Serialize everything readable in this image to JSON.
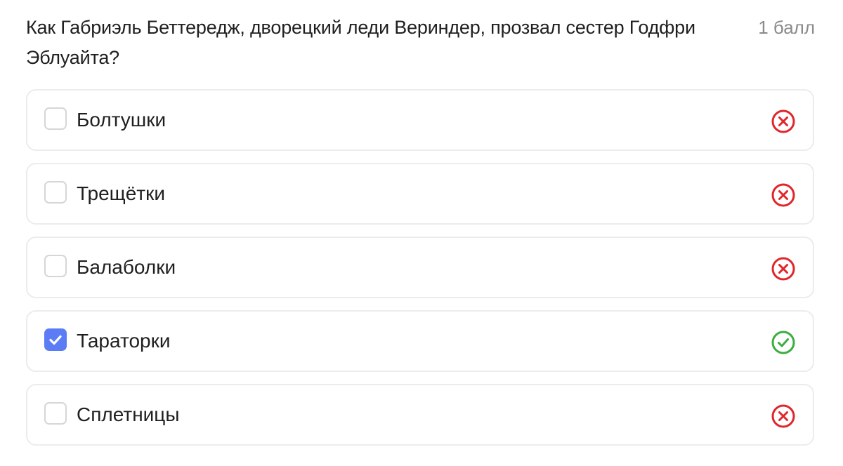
{
  "question": {
    "text": "Как Габриэль Беттередж, дворецкий леди Вериндер, прозвал сестер Годфри Эблуайта?",
    "score": "1 балл"
  },
  "options": [
    {
      "label": "Болтушки",
      "checked": false,
      "status": "incorrect",
      "icon": "x-circle-icon"
    },
    {
      "label": "Трещётки",
      "checked": false,
      "status": "incorrect",
      "icon": "x-circle-icon"
    },
    {
      "label": "Балаболки",
      "checked": false,
      "status": "incorrect",
      "icon": "x-circle-icon"
    },
    {
      "label": "Тараторки",
      "checked": true,
      "status": "correct",
      "icon": "check-circle-icon"
    },
    {
      "label": "Сплетницы",
      "checked": false,
      "status": "incorrect",
      "icon": "x-circle-icon"
    }
  ],
  "colors": {
    "incorrect": "#e0262b",
    "correct": "#3aae3f",
    "checkbox_checked": "#5b7cf5",
    "border": "#ececec"
  }
}
